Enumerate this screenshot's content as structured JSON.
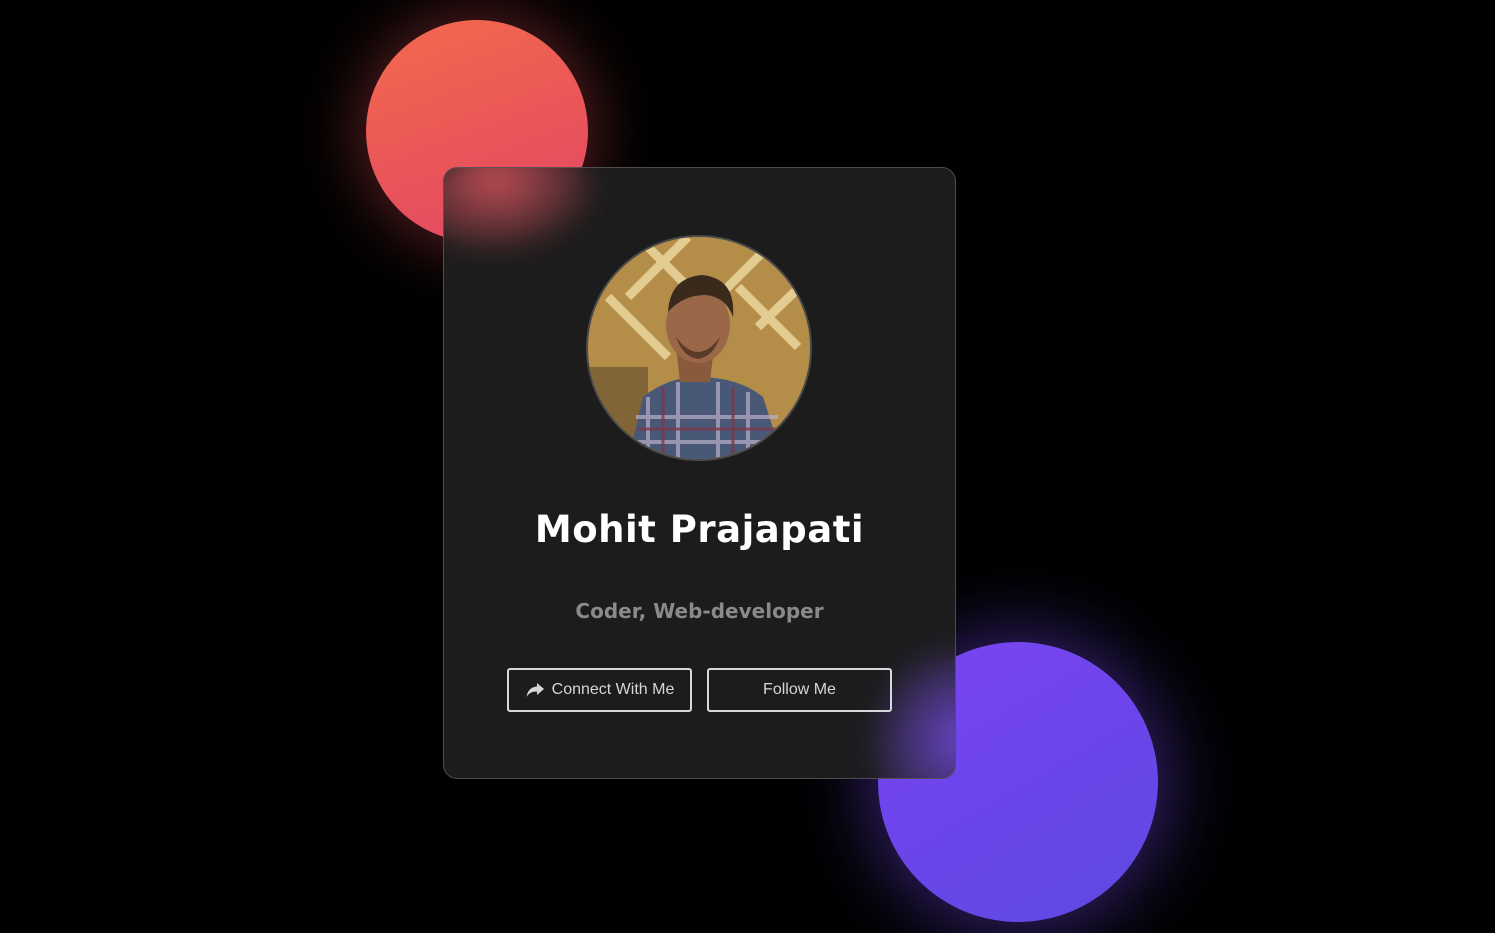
{
  "profile": {
    "name": "Mohit Prajapati",
    "role": "Coder, Web-developer",
    "avatar_alt": "Profile photo"
  },
  "actions": {
    "connect_label": "Connect With Me",
    "connect_icon": "share-icon",
    "follow_label": "Follow Me"
  },
  "theme": {
    "background": "#000000",
    "card": "#1e1e1e",
    "orb_red": "#e9535a",
    "orb_purple": "#6a45ea",
    "name_color": "#ffffff",
    "role_color": "#8a8a8a"
  }
}
